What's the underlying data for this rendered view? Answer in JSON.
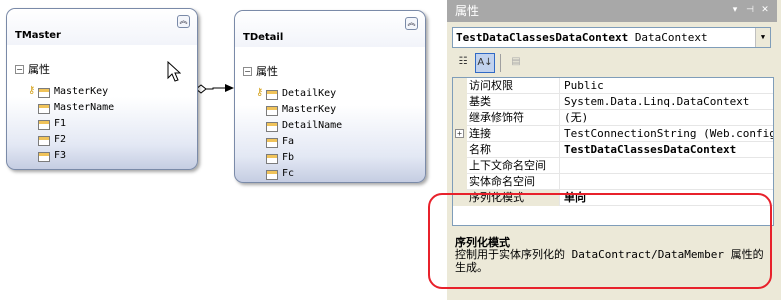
{
  "designer": {
    "master": {
      "name": "TMaster",
      "section_label": "属性",
      "properties": [
        {
          "name": "MasterKey",
          "is_key": true
        },
        {
          "name": "MasterName",
          "is_key": false
        },
        {
          "name": "F1",
          "is_key": false
        },
        {
          "name": "F2",
          "is_key": false
        },
        {
          "name": "F3",
          "is_key": false
        }
      ]
    },
    "detail": {
      "name": "TDetail",
      "section_label": "属性",
      "properties": [
        {
          "name": "DetailKey",
          "is_key": true
        },
        {
          "name": "MasterKey",
          "is_key": false
        },
        {
          "name": "DetailName",
          "is_key": false
        },
        {
          "name": "Fa",
          "is_key": false
        },
        {
          "name": "Fb",
          "is_key": false
        },
        {
          "name": "Fc",
          "is_key": false
        }
      ]
    }
  },
  "properties_panel": {
    "title": "属性",
    "object_name": "TestDataClassesDataContext",
    "object_type": "DataContext",
    "rows": [
      {
        "name": "访问权限",
        "value": "Public",
        "bold": false,
        "expandable": false
      },
      {
        "name": "基类",
        "value": "System.Data.Linq.DataContext",
        "bold": false,
        "expandable": false
      },
      {
        "name": "继承修饰符",
        "value": "(无)",
        "bold": false,
        "expandable": false
      },
      {
        "name": "连接",
        "value": "TestConnectionString (Web.config)",
        "bold": false,
        "expandable": true
      },
      {
        "name": "名称",
        "value": "TestDataClassesDataContext",
        "bold": true,
        "expandable": false
      },
      {
        "name": "上下文命名空间",
        "value": "",
        "bold": false,
        "expandable": false
      },
      {
        "name": "实体命名空间",
        "value": "",
        "bold": false,
        "expandable": false
      },
      {
        "name": "序列化模式",
        "value": "单向",
        "bold": true,
        "expandable": false
      }
    ],
    "description": {
      "title": "序列化模式",
      "text": "控制用于实体序列化的 DataContract/DataMember 属性的生成。"
    }
  },
  "colors": {
    "highlight": "#e8212b",
    "panel_title_bg": "#a8a8a8",
    "entity_border": "#7a8aa8"
  }
}
